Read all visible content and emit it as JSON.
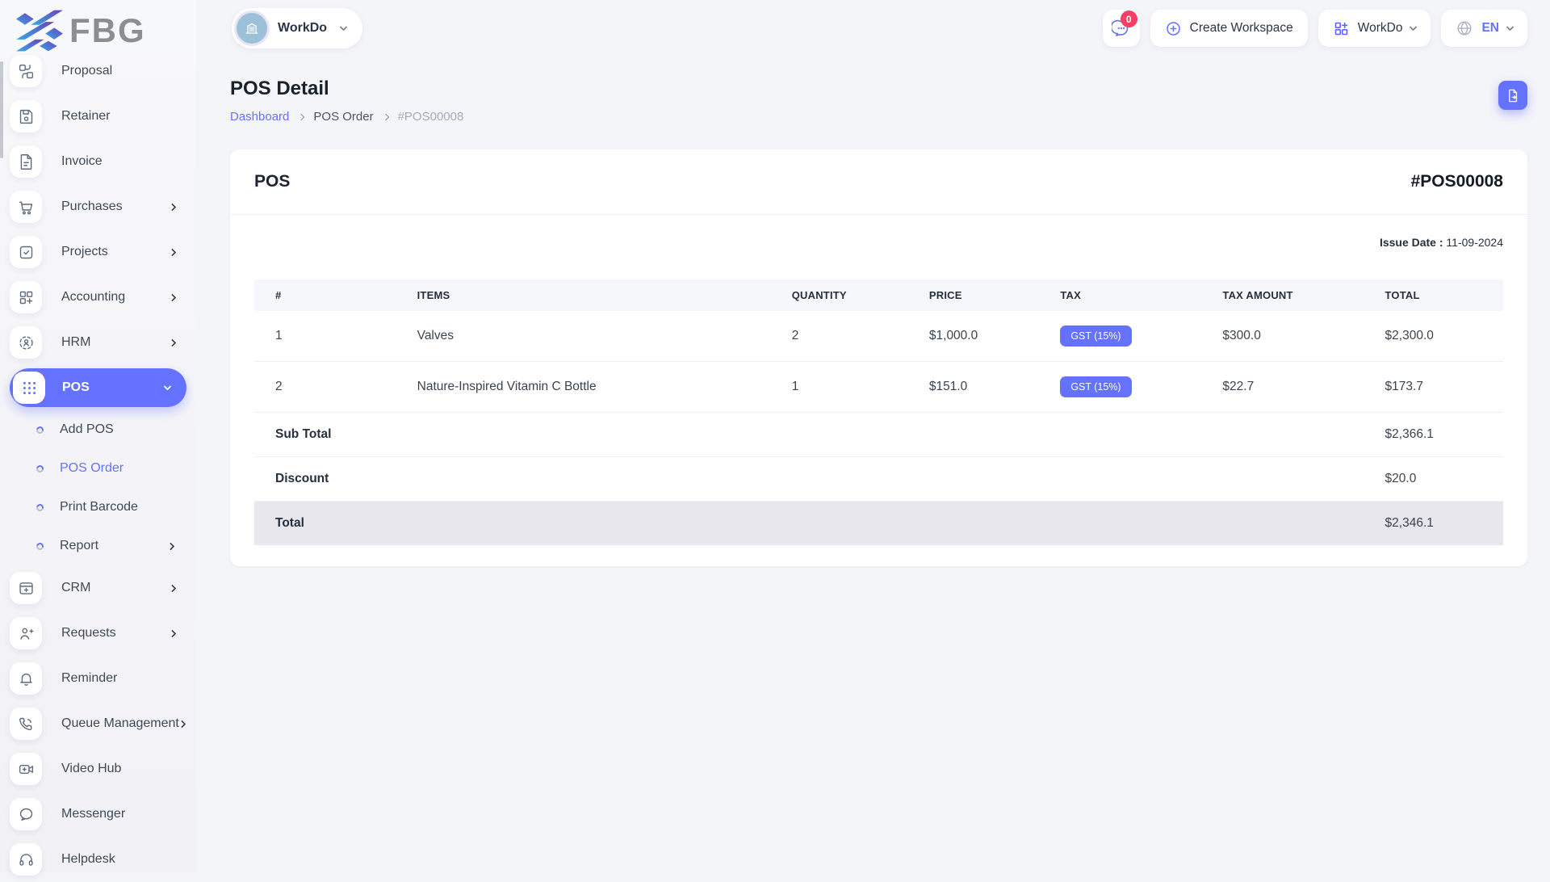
{
  "brand": {
    "name": "FBG"
  },
  "topbar": {
    "workspace": {
      "label": "WorkDo"
    },
    "messages": {
      "count": "0"
    },
    "create_workspace": {
      "label": "Create Workspace"
    },
    "app_menu": {
      "label": "WorkDo"
    },
    "language": {
      "code": "EN"
    }
  },
  "sidebar": {
    "items": [
      {
        "label": "Proposal"
      },
      {
        "label": "Retainer"
      },
      {
        "label": "Invoice"
      },
      {
        "label": "Purchases"
      },
      {
        "label": "Projects"
      },
      {
        "label": "Accounting"
      },
      {
        "label": "HRM"
      },
      {
        "label": "POS"
      },
      {
        "label": "Add POS"
      },
      {
        "label": "POS Order"
      },
      {
        "label": "Print Barcode"
      },
      {
        "label": "Report"
      },
      {
        "label": "CRM"
      },
      {
        "label": "Requests"
      },
      {
        "label": "Reminder"
      },
      {
        "label": "Queue Management"
      },
      {
        "label": "Video Hub"
      },
      {
        "label": "Messenger"
      },
      {
        "label": "Helpdesk"
      }
    ]
  },
  "page": {
    "title": "POS Detail",
    "breadcrumb": [
      "Dashboard",
      "POS Order",
      "#POS00008"
    ]
  },
  "pos": {
    "title": "POS",
    "number": "#POS00008",
    "issue_date_label": "Issue Date :",
    "issue_date_value": "11-09-2024",
    "table": {
      "headers": [
        "#",
        "ITEMS",
        "QUANTITY",
        "PRICE",
        "TAX",
        "TAX AMOUNT",
        "TOTAL"
      ],
      "rows": [
        {
          "no": "1",
          "item": "Valves",
          "qty": "2",
          "price": "$1,000.0",
          "tax": "GST (15%)",
          "tax_amount": "$300.0",
          "total": "$2,300.0"
        },
        {
          "no": "2",
          "item": "Nature-Inspired Vitamin C Bottle",
          "qty": "1",
          "price": "$151.0",
          "tax": "GST (15%)",
          "tax_amount": "$22.7",
          "total": "$173.7"
        }
      ],
      "summary": [
        {
          "label": "Sub Total",
          "value": "$2,366.1"
        },
        {
          "label": "Discount",
          "value": "$20.0"
        },
        {
          "label": "Total",
          "value": "$2,346.1"
        }
      ]
    }
  },
  "colors": {
    "accent": "#6571ff",
    "notification_badge": "#f73e64",
    "link": "#6571ff",
    "total_row_bg": "#e7e7ed"
  }
}
